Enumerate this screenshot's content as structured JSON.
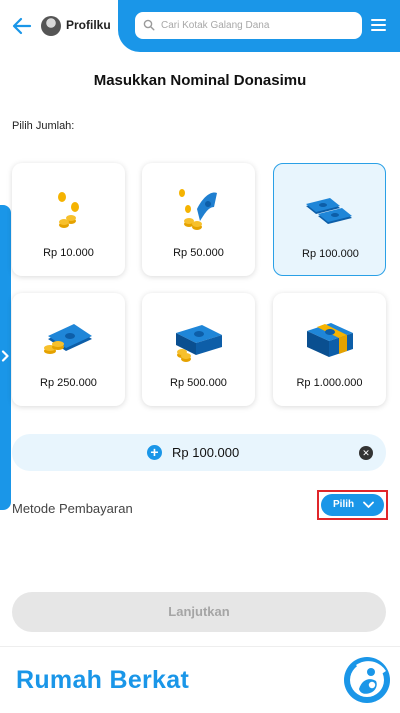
{
  "header": {
    "profile_label": "Profilku",
    "search_placeholder": "Cari Kotak Galang Dana"
  },
  "page": {
    "title": "Masukkan Nominal Donasimu",
    "choose_amount_label": "Pilih Jumlah:"
  },
  "amount_options": [
    {
      "label": "Rp 10.000",
      "icon": "coins-icon",
      "selected": false
    },
    {
      "label": "Rp 50.000",
      "icon": "coins-banknote-icon",
      "selected": false
    },
    {
      "label": "Rp 100.000",
      "icon": "banknotes-icon",
      "selected": true
    },
    {
      "label": "Rp 250.000",
      "icon": "banknote-coins-icon",
      "selected": false
    },
    {
      "label": "Rp 500.000",
      "icon": "money-stack-coins-icon",
      "selected": false
    },
    {
      "label": "Rp 1.000.000",
      "icon": "money-bundle-icon",
      "selected": false
    }
  ],
  "amount_bar": {
    "value": "Rp 100.000"
  },
  "payment": {
    "label": "Metode Pembayaran",
    "button_label": "Pilih"
  },
  "cta": {
    "label": "Lanjutkan"
  },
  "footer": {
    "brand": "Rumah Berkat"
  },
  "colors": {
    "accent": "#1a96e8",
    "selected_bg": "#e8f5fd",
    "highlight_border": "#e0262a",
    "disabled_bg": "#e6e6e6"
  }
}
